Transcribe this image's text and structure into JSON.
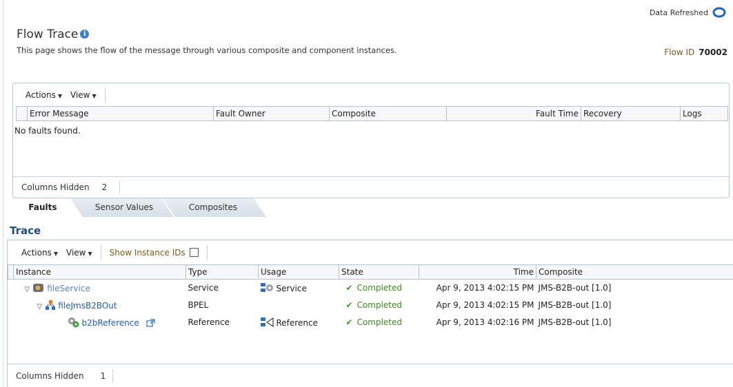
{
  "header": {
    "refresh_label": "Data Refreshed",
    "title": "Flow Trace",
    "description": "This page shows the flow of the message through various composite and component instances.",
    "flow_id_label": "Flow ID",
    "flow_id_value": "70002"
  },
  "faults": {
    "actions_label": "Actions",
    "view_label": "View",
    "columns": [
      "Error Message",
      "Fault Owner",
      "Composite",
      "Fault Time",
      "Recovery",
      "Logs"
    ],
    "empty_message": "No faults found.",
    "columns_hidden_label": "Columns Hidden",
    "columns_hidden_count": "2"
  },
  "tabs": [
    {
      "label": "Faults",
      "active": true
    },
    {
      "label": "Sensor Values",
      "active": false
    },
    {
      "label": "Composites",
      "active": false
    }
  ],
  "trace": {
    "title": "Trace",
    "actions_label": "Actions",
    "view_label": "View",
    "show_ids_label": "Show Instance IDs",
    "columns": [
      "Instance",
      "Type",
      "Usage",
      "State",
      "Time",
      "Composite"
    ],
    "rows": [
      {
        "instance": "fileService",
        "type": "Service",
        "usage": "Service",
        "state": "Completed",
        "time": "Apr 9, 2013 4:02:15 PM",
        "composite": "JMS-B2B-out [1.0]"
      },
      {
        "instance": "fileJmsB2BOut",
        "type": "BPEL",
        "usage": "",
        "state": "Completed",
        "time": "Apr 9, 2013 4:02:15 PM",
        "composite": "JMS-B2B-out [1.0]"
      },
      {
        "instance": "b2bReference",
        "type": "Reference",
        "usage": "Reference",
        "state": "Completed",
        "time": "Apr 9, 2013 4:02:16 PM",
        "composite": "JMS-B2B-out [1.0]"
      }
    ],
    "columns_hidden_label": "Columns Hidden",
    "columns_hidden_count": "1"
  },
  "colors": {
    "accent": "#1d4e80",
    "link": "#1f5fb5",
    "success": "#3a9b27",
    "flow_id_label": "#7b5b12"
  },
  "icons": [
    "refresh-icon",
    "info-icon",
    "caret-down-icon",
    "checkbox-icon",
    "expand-triangle-icon",
    "service-icon",
    "bpel-component-icon",
    "reference-icon",
    "external-link-icon",
    "check-icon"
  ]
}
